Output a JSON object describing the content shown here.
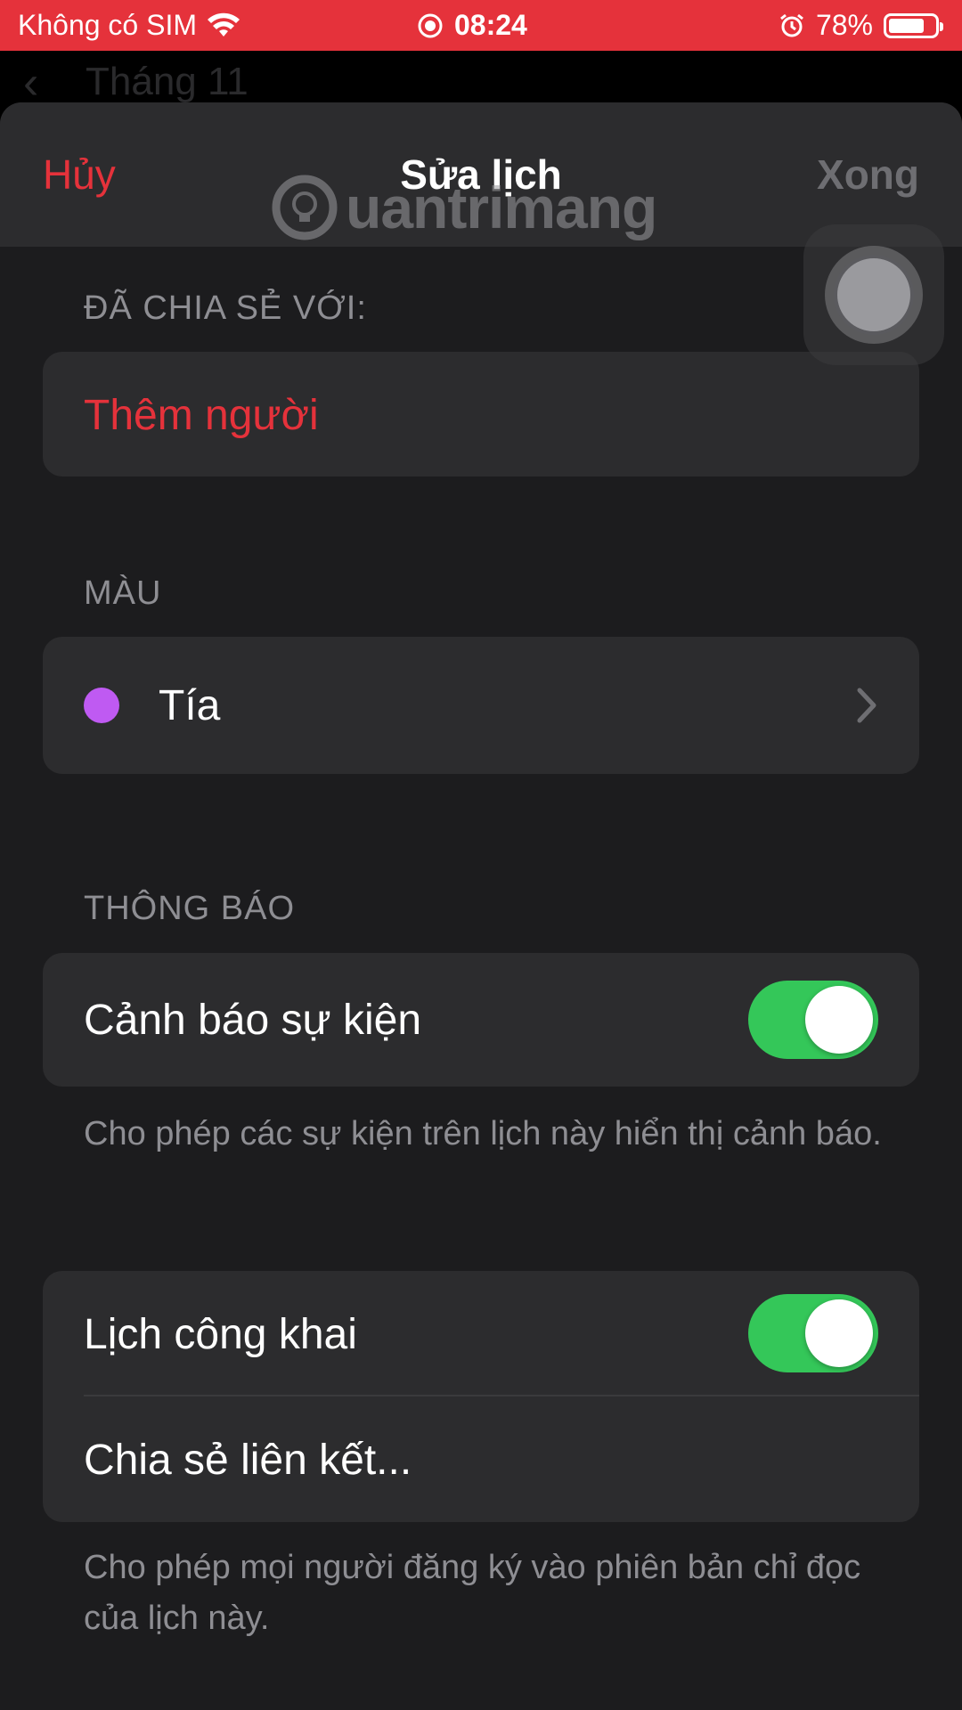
{
  "status_bar": {
    "carrier": "Không có SIM",
    "time": "08:24",
    "battery": "78%",
    "battery_level": 0.78
  },
  "background": {
    "title": "Tháng 11"
  },
  "header": {
    "cancel_label": "Hủy",
    "title": "Sửa lịch",
    "done_label": "Xong"
  },
  "watermark": "uantrimang",
  "shared_section": {
    "label": "ĐÃ CHIA SẺ VỚI:",
    "add_person": "Thêm người"
  },
  "color_section": {
    "label": "MÀU",
    "color_name": "Tía",
    "color_hex": "#bf5af2"
  },
  "notifications_section": {
    "label": "THÔNG BÁO",
    "event_alerts_label": "Cảnh báo sự kiện",
    "event_alerts_on": true,
    "footnote": "Cho phép các sự kiện trên lịch này hiển thị cảnh báo."
  },
  "public_section": {
    "public_calendar_label": "Lịch công khai",
    "public_calendar_on": true,
    "share_link_label": "Chia sẻ liên kết...",
    "footnote": "Cho phép mọi người đăng ký vào phiên bản chỉ đọc của lịch này."
  },
  "colors": {
    "accent": "#e5323b",
    "toggle_on": "#34c759"
  }
}
